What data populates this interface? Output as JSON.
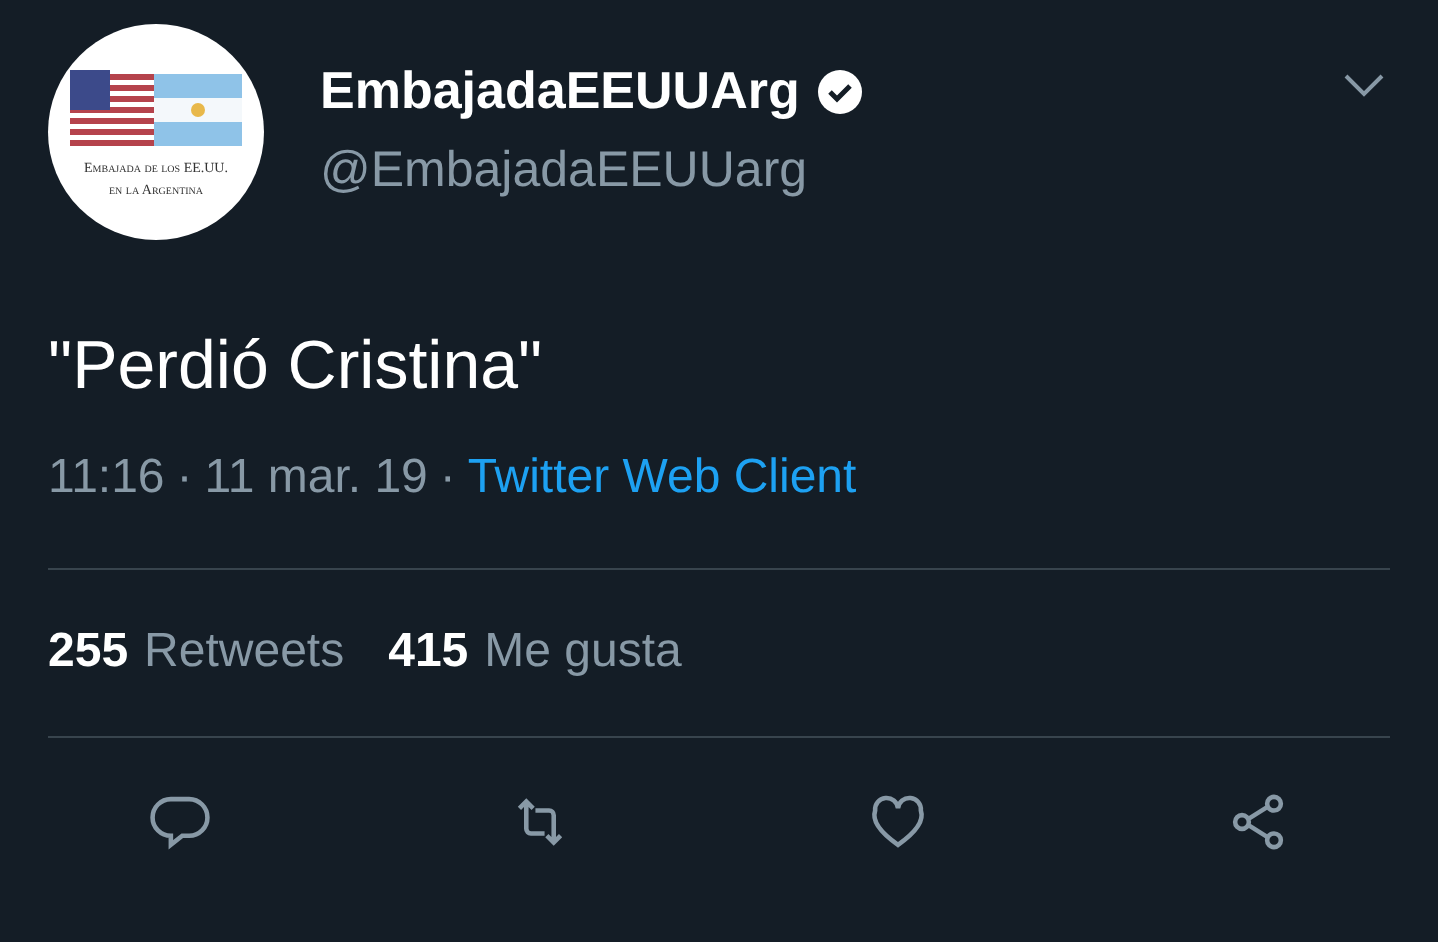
{
  "author": {
    "name": "EmbajadaEEUUArg",
    "verified": true,
    "handle": "@EmbajadaEEUUarg",
    "avatar_caption": [
      "Embajada de los EE.UU.",
      "en la Argentina"
    ]
  },
  "tweet": {
    "text": "\"Perdió Cristina\"",
    "time": "11:16",
    "date": "11 mar. 19",
    "source": "Twitter Web Client",
    "separator": "·"
  },
  "stats": [
    {
      "count": "255",
      "label": "Retweets"
    },
    {
      "count": "415",
      "label": "Me gusta"
    }
  ],
  "actions": [
    {
      "kind": "reply"
    },
    {
      "kind": "retweet"
    },
    {
      "kind": "like"
    },
    {
      "kind": "share"
    }
  ]
}
